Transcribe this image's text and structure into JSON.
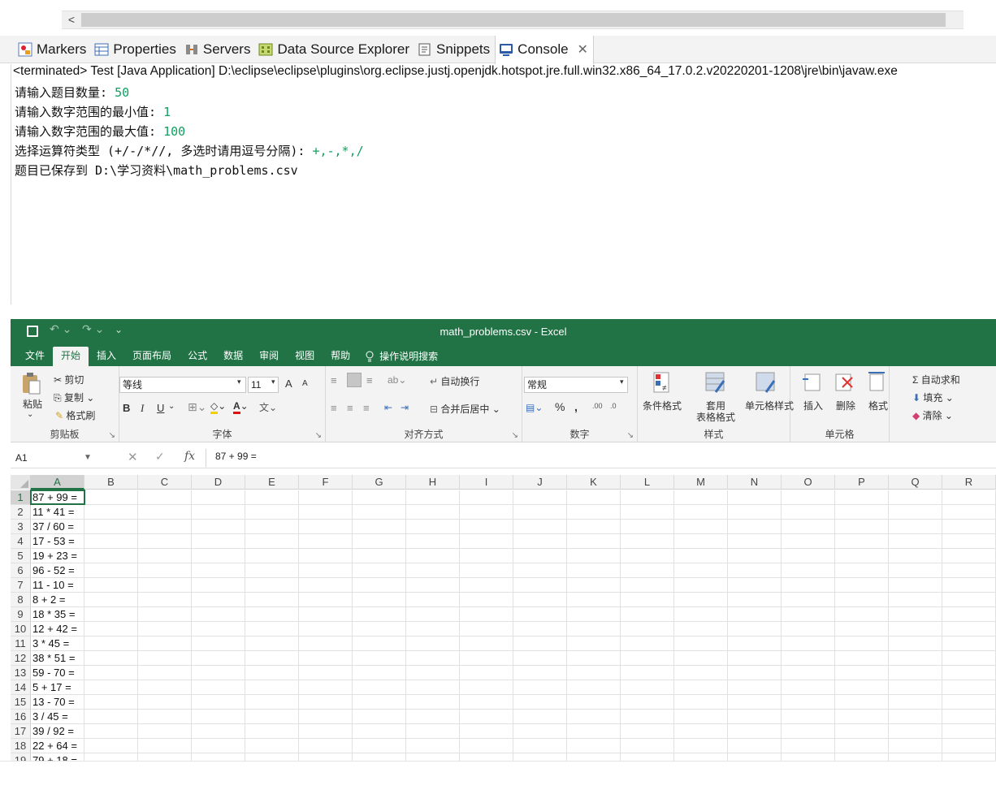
{
  "eclipse": {
    "scroll_left": "<",
    "tabs": [
      {
        "label": "Markers",
        "icon": "markers-icon"
      },
      {
        "label": "Properties",
        "icon": "properties-icon"
      },
      {
        "label": "Servers",
        "icon": "servers-icon"
      },
      {
        "label": "Data Source Explorer",
        "icon": "data-source-explorer-icon"
      },
      {
        "label": "Snippets",
        "icon": "snippets-icon"
      },
      {
        "label": "Console",
        "icon": "console-icon",
        "active": true
      }
    ],
    "close_glyph": "✕",
    "terminated": "<terminated> Test [Java Application] D:\\eclipse\\eclipse\\plugins\\org.eclipse.justj.openjdk.hotspot.jre.full.win32.x86_64_17.0.2.v20220201-1208\\jre\\bin\\javaw.exe",
    "console": [
      {
        "prompt": "请输入题目数量: ",
        "input": "50"
      },
      {
        "prompt": "请输入数字范围的最小值: ",
        "input": "1"
      },
      {
        "prompt": "请输入数字范围的最大值: ",
        "input": "100"
      },
      {
        "prompt": "选择运算符类型 (+/-/*//, 多选时请用逗号分隔): ",
        "input": "+,-,*,/"
      },
      {
        "prompt": "题目已保存到 D:\\学习资料\\math_problems.csv",
        "input": ""
      }
    ]
  },
  "excel": {
    "window_title": "math_problems.csv  -  Excel",
    "qa_undo": "↶ ⌄",
    "qa_redo": "↷ ⌄",
    "qa_more": "⌄",
    "menu": [
      "文件",
      "开始",
      "插入",
      "页面布局",
      "公式",
      "数据",
      "审阅",
      "视图",
      "帮助"
    ],
    "active_menu": "开始",
    "search_hint": "操作说明搜索",
    "ribbon": {
      "clipboard": {
        "paste": "粘贴",
        "cut": "剪切",
        "copy": "复制",
        "format_painter": "格式刷",
        "label": "剪贴板"
      },
      "font": {
        "name": "等线",
        "size": "11",
        "bold": "B",
        "italic": "I",
        "underline": "U",
        "grow": "A",
        "shrink": "A",
        "label": "字体"
      },
      "alignment": {
        "wrap": "自动换行",
        "merge": "合并后居中",
        "label": "对齐方式"
      },
      "number": {
        "format": "常规",
        "percent": "%",
        "comma": ",",
        "label": "数字"
      },
      "styles": {
        "conditional": "条件格式",
        "table1": "套用",
        "table2": "表格格式",
        "cell_styles": "单元格样式",
        "label": "样式"
      },
      "cells": {
        "insert": "插入",
        "delete": "删除",
        "format": "格式",
        "label": "单元格"
      },
      "editing": {
        "autosum": "Σ 自动求和",
        "fill": "填充",
        "clear": "清除"
      }
    },
    "name_box": "A1",
    "formula_cancel": "✕",
    "formula_enter": "✓",
    "formula_fx": "fx",
    "formula": "87 + 99 =",
    "columns": [
      "A",
      "B",
      "C",
      "D",
      "E",
      "F",
      "G",
      "H",
      "I",
      "J",
      "K",
      "L",
      "M",
      "N",
      "O",
      "P",
      "Q",
      "R"
    ],
    "rows": [
      {
        "n": "1",
        "a": "87 + 99 ="
      },
      {
        "n": "2",
        "a": "11 * 41 ="
      },
      {
        "n": "3",
        "a": "37 / 60 ="
      },
      {
        "n": "4",
        "a": "17 - 53 ="
      },
      {
        "n": "5",
        "a": "19 + 23 ="
      },
      {
        "n": "6",
        "a": "96 - 52 ="
      },
      {
        "n": "7",
        "a": "11 - 10 ="
      },
      {
        "n": "8",
        "a": "8 + 2 ="
      },
      {
        "n": "9",
        "a": "18 * 35 ="
      },
      {
        "n": "10",
        "a": "12 + 42 ="
      },
      {
        "n": "11",
        "a": "3 * 45 ="
      },
      {
        "n": "12",
        "a": "38 * 51 ="
      },
      {
        "n": "13",
        "a": "59 - 70 ="
      },
      {
        "n": "14",
        "a": "5 + 17 ="
      },
      {
        "n": "15",
        "a": "13 - 70 ="
      },
      {
        "n": "16",
        "a": "3 / 45 ="
      },
      {
        "n": "17",
        "a": "39 / 92 ="
      },
      {
        "n": "18",
        "a": "22 + 64 ="
      },
      {
        "n": "19",
        "a": "79 + 18 ="
      }
    ]
  }
}
